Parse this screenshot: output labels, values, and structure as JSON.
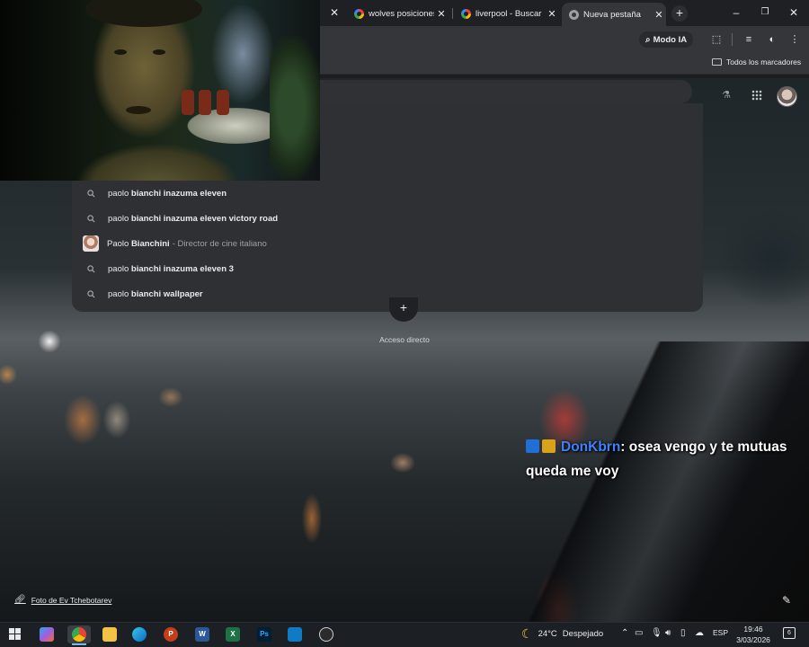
{
  "browser": {
    "tabs": [
      {
        "title": "wolves posiciones",
        "active": false
      },
      {
        "title": "liverpool - Buscar",
        "active": false
      },
      {
        "title": "Nueva pestaña",
        "active": true
      }
    ],
    "new_tab_icon": "plus-icon",
    "window_controls": {
      "minimize": "–",
      "maximize": "❐",
      "close": "✕"
    },
    "toolbar": {
      "ai_mode_label": "Modo IA"
    },
    "bookmarks_bar": {
      "all_bookmarks_label": "Todos los marcadores"
    }
  },
  "omnibox": {
    "suggestions": [
      {
        "type": "search",
        "prefix": "paolo ",
        "bold": "bianchi inazuma eleven",
        "rest": ""
      },
      {
        "type": "search",
        "prefix": "paolo ",
        "bold": "bianchi inazuma eleven victory road",
        "rest": ""
      },
      {
        "type": "entity",
        "prefix": "Paolo ",
        "bold": "Bianchini",
        "rest": "",
        "description": "- Director de cine italiano"
      },
      {
        "type": "search",
        "prefix": "paolo ",
        "bold": "bianchi inazuma eleven 3",
        "rest": ""
      },
      {
        "type": "search",
        "prefix": "paolo ",
        "bold": "bianchi wallpaper",
        "rest": ""
      }
    ]
  },
  "ntp": {
    "add_shortcut_icon": "+",
    "add_shortcut_label": "Acceso directo",
    "photo_credit": "Foto de Ev Tchebotarev"
  },
  "chat_overlay": {
    "username": "DonKbrn",
    "message": ": osea vengo y te mutuas queda me voy",
    "colors": {
      "username": "#3e82ff"
    }
  },
  "taskbar": {
    "weather": {
      "temp": "24°C",
      "condition": "Despejado"
    },
    "language": "ESP",
    "time": "19:46",
    "date": "3/03/2026",
    "notification_count": "6"
  }
}
